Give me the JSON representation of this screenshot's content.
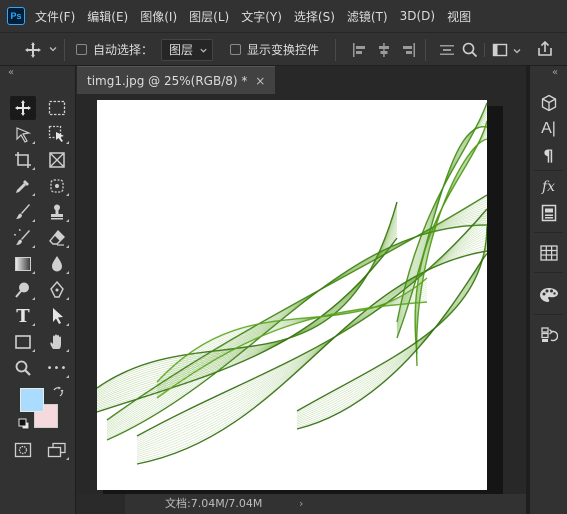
{
  "app": {
    "logo_text": "Ps"
  },
  "menu": [
    "文件(F)",
    "编辑(E)",
    "图像(I)",
    "图层(L)",
    "文字(Y)",
    "选择(S)",
    "滤镜(T)",
    "3D(D)",
    "视图"
  ],
  "options_bar": {
    "auto_select_label": "自动选择：",
    "auto_select_checked": false,
    "layer_dropdown_value": "图层",
    "show_transform_label": "显示变换控件",
    "show_transform_checked": false
  },
  "document": {
    "tab_title": "timg1.jpg @ 25%(RGB/8) *",
    "tab_close": "×",
    "status_text": "文档:7.04M/7.04M",
    "status_arrow": "›"
  },
  "colors": {
    "foreground": "#a9dcff",
    "background": "#f6d9dc",
    "accent_green": "#4f9a14"
  },
  "left_tools": [
    "move-tool-icon",
    "rectangular-marquee-icon",
    "lasso-tool-icon",
    "object-selection-icon",
    "crop-tool-icon",
    "frame-tool-icon",
    "eyedropper-icon",
    "spot-healing-icon",
    "brush-tool-icon",
    "clone-stamp-icon",
    "history-brush-icon",
    "eraser-icon",
    "gradient-tool-icon",
    "blur-tool-icon",
    "dodge-tool-icon",
    "pen-tool-icon",
    "type-tool-icon",
    "path-selection-icon",
    "rectangle-tool-icon",
    "hand-tool-icon",
    "zoom-tool-icon",
    "more-tools-icon"
  ],
  "right_tools": [
    "3d-icon",
    "character-icon",
    "paragraph-icon",
    "styles-icon",
    "properties-icon",
    "swatches-icon",
    "color-palette-icon",
    "history-icon"
  ],
  "right_labels": {
    "character": "A|",
    "paragraph": "¶",
    "styles": "fx"
  },
  "glyphs": {
    "collapse": "«",
    "type_tool": "T",
    "more_tools": "•••"
  }
}
